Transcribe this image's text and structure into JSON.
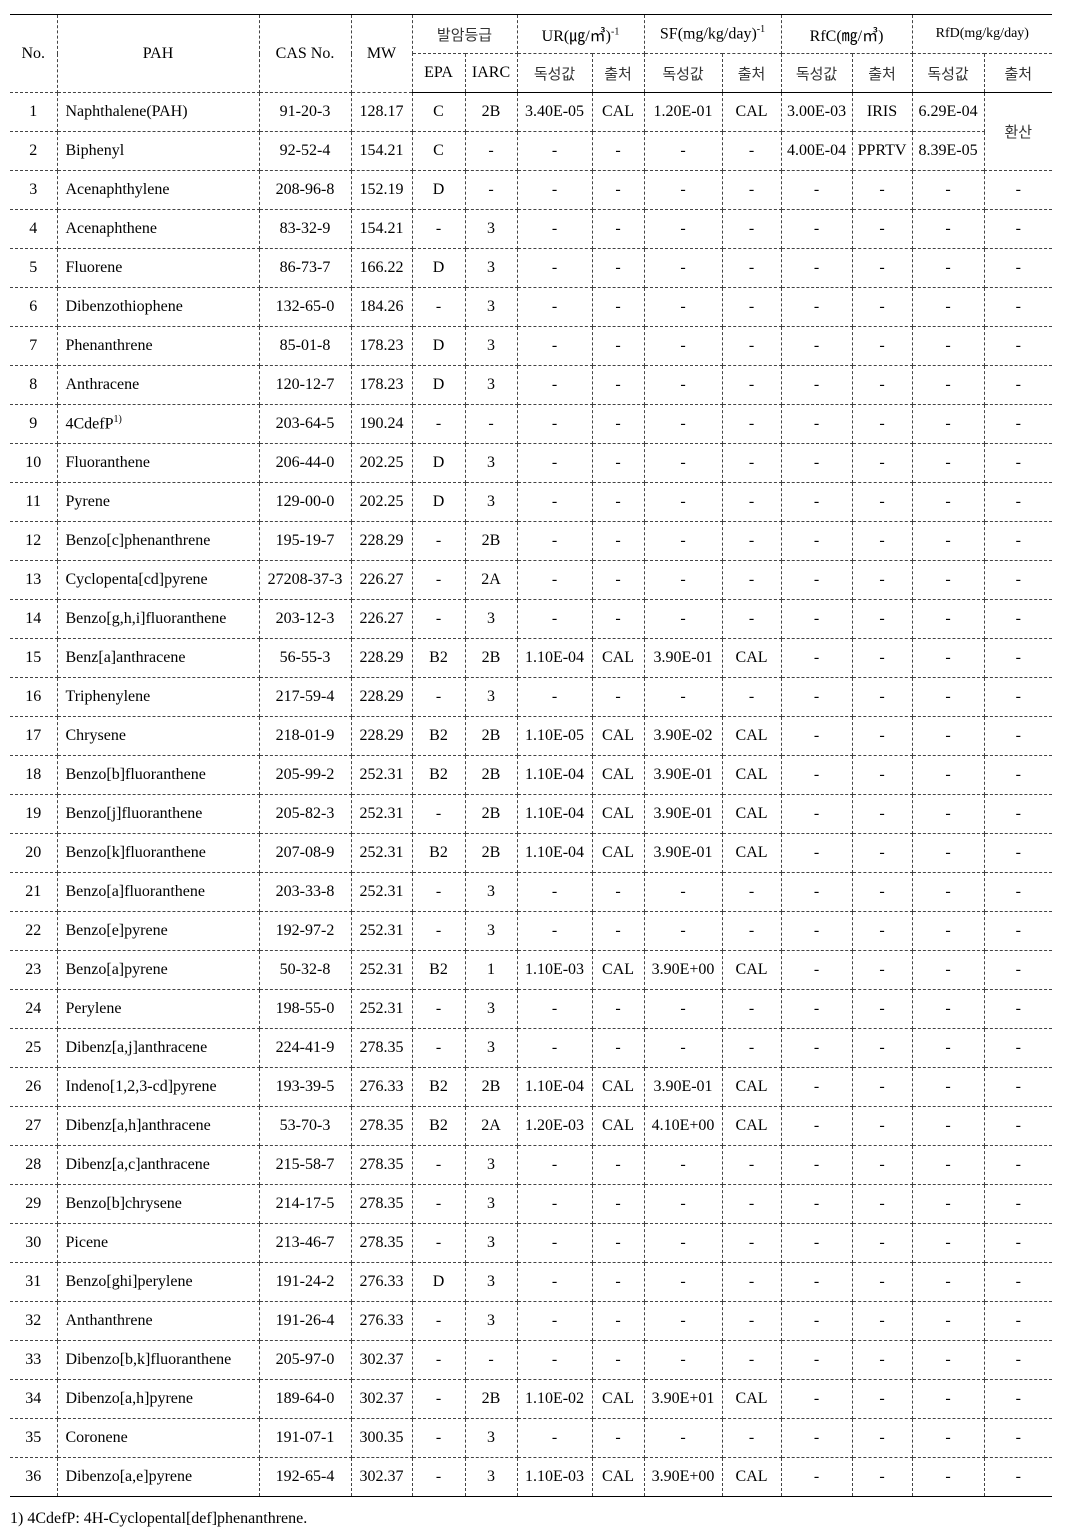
{
  "headers": {
    "no": "No.",
    "pah": "PAH",
    "cas": "CAS  No.",
    "mw": "MW",
    "grade": "발암등급",
    "ur": "UR(㎍/㎥)",
    "ur_sup": "-1",
    "sf": "SF(mg/kg/day)",
    "sf_sup": "-1",
    "rfc": "RfC(㎎/㎥)",
    "rfd": "RfD(mg/kg/day)",
    "epa": "EPA",
    "iarc": "IARC",
    "value": "독성값",
    "source": "출처"
  },
  "rfd_source_merged": "환산",
  "rows": [
    [
      "1",
      "Naphthalene(PAH)",
      "91-20-3",
      "128.17",
      "C",
      "2B",
      "3.40E-05",
      "CAL",
      "1.20E-01",
      "CAL",
      "3.00E-03",
      "IRIS",
      "6.29E-04"
    ],
    [
      "2",
      "Biphenyl",
      "92-52-4",
      "154.21",
      "C",
      "-",
      "-",
      "-",
      "-",
      "-",
      "4.00E-04",
      "PPRTV",
      "8.39E-05"
    ],
    [
      "3",
      "Acenaphthylene",
      "208-96-8",
      "152.19",
      "D",
      "-",
      "-",
      "-",
      "-",
      "-",
      "-",
      "-",
      "-",
      "-"
    ],
    [
      "4",
      "Acenaphthene",
      "83-32-9",
      "154.21",
      "-",
      "3",
      "-",
      "-",
      "-",
      "-",
      "-",
      "-",
      "-",
      "-"
    ],
    [
      "5",
      "Fluorene",
      "86-73-7",
      "166.22",
      "D",
      "3",
      "-",
      "-",
      "-",
      "-",
      "-",
      "-",
      "-",
      "-"
    ],
    [
      "6",
      "Dibenzothiophene",
      "132-65-0",
      "184.26",
      "-",
      "3",
      "-",
      "-",
      "-",
      "-",
      "-",
      "-",
      "-",
      "-"
    ],
    [
      "7",
      "Phenanthrene",
      "85-01-8",
      "178.23",
      "D",
      "3",
      "-",
      "-",
      "-",
      "-",
      "-",
      "-",
      "-",
      "-"
    ],
    [
      "8",
      "Anthracene",
      "120-12-7",
      "178.23",
      "D",
      "3",
      "-",
      "-",
      "-",
      "-",
      "-",
      "-",
      "-",
      "-"
    ],
    [
      "9",
      "4CdefP",
      "203-64-5",
      "190.24",
      "-",
      "-",
      "-",
      "-",
      "-",
      "-",
      "-",
      "-",
      "-",
      "-"
    ],
    [
      "10",
      "Fluoranthene",
      "206-44-0",
      "202.25",
      "D",
      "3",
      "-",
      "-",
      "-",
      "-",
      "-",
      "-",
      "-",
      "-"
    ],
    [
      "11",
      "Pyrene",
      "129-00-0",
      "202.25",
      "D",
      "3",
      "-",
      "-",
      "-",
      "-",
      "-",
      "-",
      "-",
      "-"
    ],
    [
      "12",
      "Benzo[c]phenanthrene",
      "195-19-7",
      "228.29",
      "-",
      "2B",
      "-",
      "-",
      "-",
      "-",
      "-",
      "-",
      "-",
      "-"
    ],
    [
      "13",
      "Cyclopenta[cd]pyrene",
      "27208-37-3",
      "226.27",
      "-",
      "2A",
      "-",
      "-",
      "-",
      "-",
      "-",
      "-",
      "-",
      "-"
    ],
    [
      "14",
      "Benzo[g,h,i]fluoranthene",
      "203-12-3",
      "226.27",
      "-",
      "3",
      "-",
      "-",
      "-",
      "-",
      "-",
      "-",
      "-",
      "-"
    ],
    [
      "15",
      "Benz[a]anthracene",
      "56-55-3",
      "228.29",
      "B2",
      "2B",
      "1.10E-04",
      "CAL",
      "3.90E-01",
      "CAL",
      "-",
      "-",
      "-",
      "-"
    ],
    [
      "16",
      "Triphenylene",
      "217-59-4",
      "228.29",
      "-",
      "3",
      "-",
      "-",
      "-",
      "-",
      "-",
      "-",
      "-",
      "-"
    ],
    [
      "17",
      "Chrysene",
      "218-01-9",
      "228.29",
      "B2",
      "2B",
      "1.10E-05",
      "CAL",
      "3.90E-02",
      "CAL",
      "-",
      "-",
      "-",
      "-"
    ],
    [
      "18",
      "Benzo[b]fluoranthene",
      "205-99-2",
      "252.31",
      "B2",
      "2B",
      "1.10E-04",
      "CAL",
      "3.90E-01",
      "CAL",
      "-",
      "-",
      "-",
      "-"
    ],
    [
      "19",
      "Benzo[j]fluoranthene",
      "205-82-3",
      "252.31",
      "-",
      "2B",
      "1.10E-04",
      "CAL",
      "3.90E-01",
      "CAL",
      "-",
      "-",
      "-",
      "-"
    ],
    [
      "20",
      "Benzo[k]fluoranthene",
      "207-08-9",
      "252.31",
      "B2",
      "2B",
      "1.10E-04",
      "CAL",
      "3.90E-01",
      "CAL",
      "-",
      "-",
      "-",
      "-"
    ],
    [
      "21",
      "Benzo[a]fluoranthene",
      "203-33-8",
      "252.31",
      "-",
      "3",
      "-",
      "-",
      "-",
      "-",
      "-",
      "-",
      "-",
      "-"
    ],
    [
      "22",
      "Benzo[e]pyrene",
      "192-97-2",
      "252.31",
      "-",
      "3",
      "-",
      "-",
      "-",
      "-",
      "-",
      "-",
      "-",
      "-"
    ],
    [
      "23",
      "Benzo[a]pyrene",
      "50-32-8",
      "252.31",
      "B2",
      "1",
      "1.10E-03",
      "CAL",
      "3.90E+00",
      "CAL",
      "-",
      "-",
      "-",
      "-"
    ],
    [
      "24",
      "Perylene",
      "198-55-0",
      "252.31",
      "-",
      "3",
      "-",
      "-",
      "-",
      "-",
      "-",
      "-",
      "-",
      "-"
    ],
    [
      "25",
      "Dibenz[a,j]anthracene",
      "224-41-9",
      "278.35",
      "-",
      "3",
      "-",
      "-",
      "-",
      "-",
      "-",
      "-",
      "-",
      "-"
    ],
    [
      "26",
      "Indeno[1,2,3-cd]pyrene",
      "193-39-5",
      "276.33",
      "B2",
      "2B",
      "1.10E-04",
      "CAL",
      "3.90E-01",
      "CAL",
      "-",
      "-",
      "-",
      "-"
    ],
    [
      "27",
      "Dibenz[a,h]anthracene",
      "53-70-3",
      "278.35",
      "B2",
      "2A",
      "1.20E-03",
      "CAL",
      "4.10E+00",
      "CAL",
      "-",
      "-",
      "-",
      "-"
    ],
    [
      "28",
      "Dibenz[a,c]anthracene",
      "215-58-7",
      "278.35",
      "-",
      "3",
      "-",
      "-",
      "-",
      "-",
      "-",
      "-",
      "-",
      "-"
    ],
    [
      "29",
      "Benzo[b]chrysene",
      "214-17-5",
      "278.35",
      "-",
      "3",
      "-",
      "-",
      "-",
      "-",
      "-",
      "-",
      "-",
      "-"
    ],
    [
      "30",
      "Picene",
      "213-46-7",
      "278.35",
      "-",
      "3",
      "-",
      "-",
      "-",
      "-",
      "-",
      "-",
      "-",
      "-"
    ],
    [
      "31",
      "Benzo[ghi]perylene",
      "191-24-2",
      "276.33",
      "D",
      "3",
      "-",
      "-",
      "-",
      "-",
      "-",
      "-",
      "-",
      "-"
    ],
    [
      "32",
      "Anthanthrene",
      "191-26-4",
      "276.33",
      "-",
      "3",
      "-",
      "-",
      "-",
      "-",
      "-",
      "-",
      "-",
      "-"
    ],
    [
      "33",
      "Dibenzo[b,k]fluoranthene",
      "205-97-0",
      "302.37",
      "-",
      "-",
      "-",
      "-",
      "-",
      "-",
      "-",
      "-",
      "-",
      "-"
    ],
    [
      "34",
      "Dibenzo[a,h]pyrene",
      "189-64-0",
      "302.37",
      "-",
      "2B",
      "1.10E-02",
      "CAL",
      "3.90E+01",
      "CAL",
      "-",
      "-",
      "-",
      "-"
    ],
    [
      "35",
      "Coronene",
      "191-07-1",
      "300.35",
      "-",
      "3",
      "-",
      "-",
      "-",
      "-",
      "-",
      "-",
      "-",
      "-"
    ],
    [
      "36",
      "Dibenzo[a,e]pyrene",
      "192-65-4",
      "302.37",
      "-",
      "3",
      "1.10E-03",
      "CAL",
      "3.90E+00",
      "CAL",
      "-",
      "-",
      "-",
      "-"
    ]
  ],
  "row9_footnote_mark": "1)",
  "footnote": "1)  4CdefP:  4H-Cyclopental[def]phenanthrene."
}
